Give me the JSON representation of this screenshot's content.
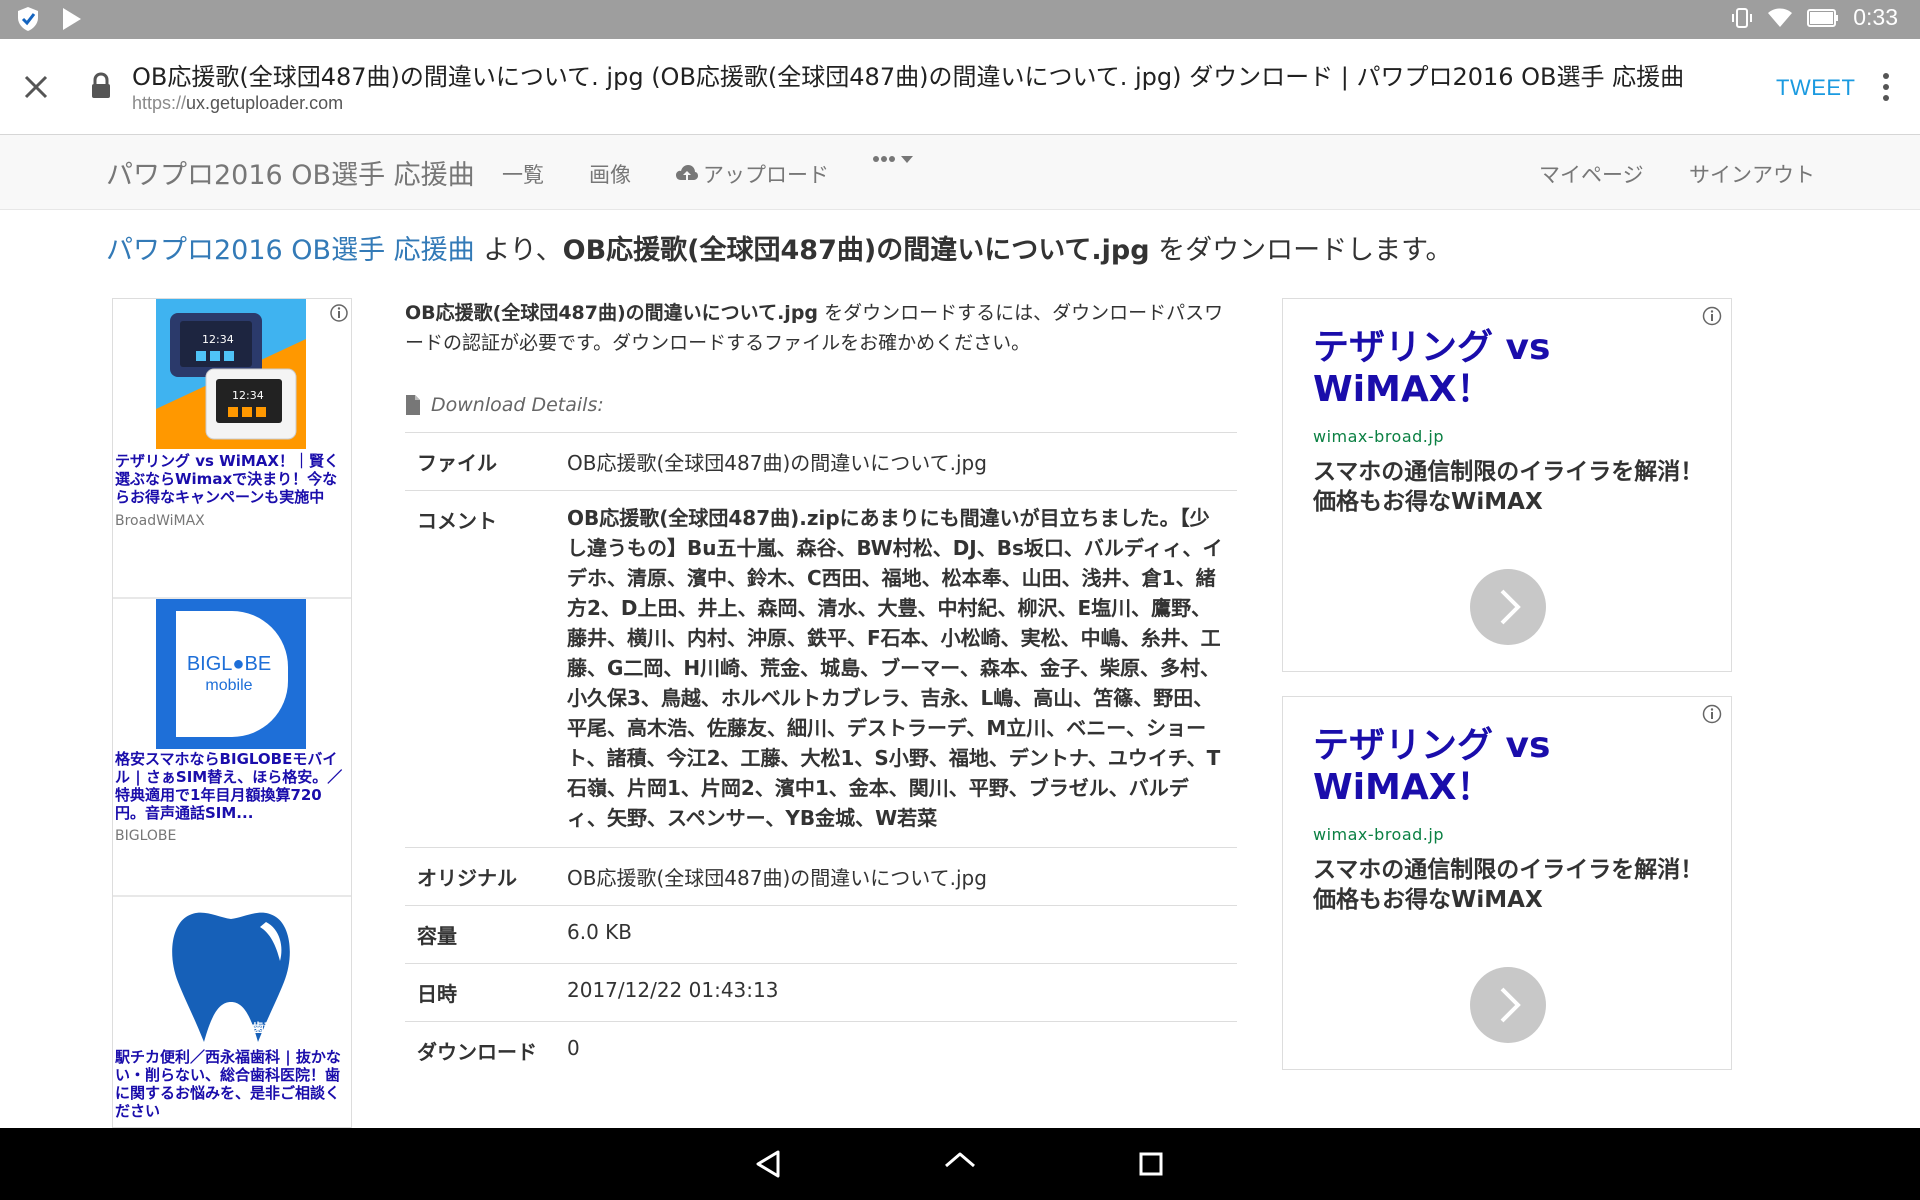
{
  "status_bar": {
    "time": "0:33"
  },
  "browser": {
    "title": "OB応援歌(全球団487曲)の間違いについて. jpg (OB応援歌(全球団487曲)の間違いについて. jpg) ダウンロード | パワプロ2016 OB選手 応援曲",
    "url_scheme": "https://",
    "url_host": "ux.getuploader.com",
    "tweet_label": "TWEET"
  },
  "site_nav": {
    "brand": "パワプロ2016 OB選手 応援曲",
    "items": [
      "一覧",
      "画像",
      "アップロード"
    ],
    "right_items": [
      "マイページ",
      "サインアウト"
    ]
  },
  "headline": {
    "link": "パワプロ2016 OB選手 応援曲",
    "from": " より、",
    "filename": "OB応援歌(全球団487曲)の間違いについて.jpg",
    "suffix": " をダウンロードします。"
  },
  "intro": {
    "filename": "OB応援歌(全球団487曲)の間違いについて.jpg",
    "text": " をダウンロードするには、ダウンロードパスワードの認証が必要です。ダウンロードするファイルをお確かめください。"
  },
  "details": {
    "heading": "Download Details:",
    "rows": [
      {
        "key": "ファイル",
        "value": "OB応援歌(全球団487曲)の間違いについて.jpg"
      },
      {
        "key": "コメント",
        "value": "OB応援歌(全球団487曲).zipにあまりにも間違いが目立ちました。【少し違うもの】Bu五十嵐、森谷、BW村松、DJ、Bs坂口、バルディィ、イデホ、清原、濱中、鈴木、C西田、福地、松本奉、山田、浅井、倉1、緒方2、D上田、井上、森岡、清水、大豊、中村紀、柳沢、E塩川、鷹野、藤井、横川、内村、沖原、鉄平、F石本、小松崎、実松、中嶋、糸井、工藤、G二岡、H川崎、荒金、城島、ブーマー、森本、金子、柴原、多村、小久保3、鳥越、ホルベルトカブレラ、吉永、L嶋、高山、笘篠、野田、平尾、高木浩、佐藤友、細川、デストラーデ、M立川、ベニー、ショート、諸積、今江2、工藤、大松1、S小野、福地、デントナ、ユウイチ、T石嶺、片岡1、片岡2、濱中1、金本、関川、平野、ブラゼル、バルディ、矢野、スペンサー、YB金城、W若菜"
      },
      {
        "key": "オリジナル",
        "value": "OB応援歌(全球団487曲)の間違いについて.jpg"
      },
      {
        "key": "容量",
        "value": "6.0 KB"
      },
      {
        "key": "日時",
        "value": "2017/12/22 01:43:13"
      },
      {
        "key": "ダウンロード",
        "value": "0"
      }
    ]
  },
  "left_ads": [
    {
      "text": "テザリング vs WiMAX！｜賢く選ぶならWimaxで決まり！今ならお得なキャンペーンも実施中",
      "source": "BroadWiMAX"
    },
    {
      "text": "格安スマホならBIGLOBEモバイル | さぁSIM替え、ほら格安。／特典適用で1年目月額換算720円。音声通話SIM...",
      "source": "BIGLOBE",
      "logo_line1": "BIGL●BE",
      "logo_line2": "mobile"
    },
    {
      "text": "駅チカ便利／西永福歯科 | 抜かない・削らない、総合歯科医院！歯に関するお悩みを、是非ご相談ください",
      "logo_text": "西永福歯科"
    }
  ],
  "right_ads": [
    {
      "title": "テザリング vs WiMAX！",
      "domain": "wimax-broad.jp",
      "desc": "スマホの通信制限のイライラを解消！価格もお得なWiMAX"
    },
    {
      "title": "テザリング vs WiMAX！",
      "domain": "wimax-broad.jp",
      "desc": "スマホの通信制限のイライラを解消！価格もお得なWiMAX"
    }
  ],
  "colors": {
    "link": "#337ab7",
    "ad_title": "#1a0dab",
    "ad_domain": "#0b8043",
    "tweet": "#1a9ae0",
    "status_bar": "#9e9e9e"
  }
}
